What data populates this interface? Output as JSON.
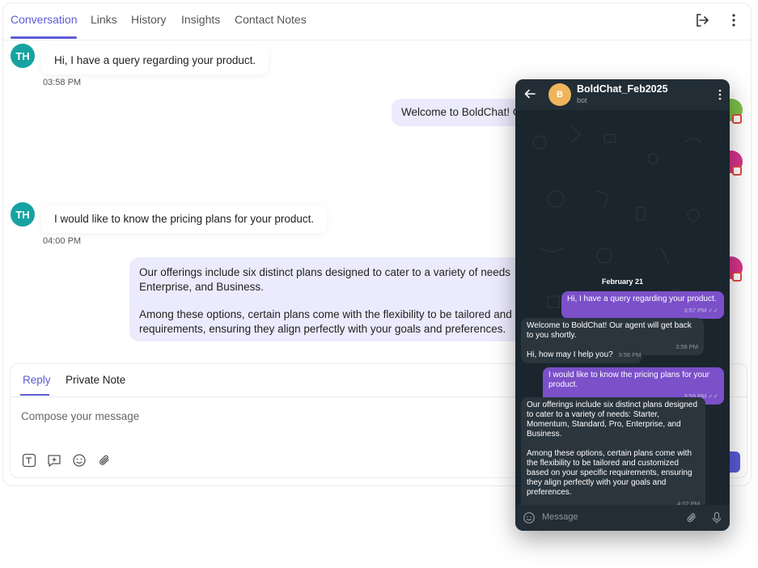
{
  "tabs": [
    {
      "label": "Conversation"
    },
    {
      "label": "Links"
    },
    {
      "label": "History"
    },
    {
      "label": "Insights"
    },
    {
      "label": "Contact Notes"
    }
  ],
  "header_icons": [
    "logout-icon",
    "more-vertical-icon"
  ],
  "messages": [
    {
      "avatar": "TH",
      "text": "Hi, I have a query regarding your product.",
      "time": "03:58 PM"
    },
    {
      "text": "Welcome to BoldChat! O"
    },
    {
      "avatar": "TH",
      "text": "I would like to know the pricing plans for your product.",
      "time": "04:00 PM"
    },
    {
      "line1": "Our offerings include six distinct plans designed to cater to a variety of needs",
      "line2": "Enterprise, and Business.",
      "line3": "Among these options, certain plans come with the flexibility to be tailored and",
      "line4": "requirements, ensuring they align perfectly with your goals and preferences."
    }
  ],
  "composer": {
    "tabs": [
      {
        "label": "Reply"
      },
      {
        "label": "Private Note"
      }
    ],
    "placeholder": "Compose your message",
    "tools": [
      "text-format-icon",
      "quick-reply-icon",
      "emoji-icon",
      "attachment-icon"
    ]
  },
  "phone": {
    "avatar": "B",
    "title": "BoldChat_Feb2025",
    "subtitle": "bot",
    "date": "February 21",
    "messages": [
      {
        "side": "out",
        "text": "Hi, I have a query regarding your product.",
        "time": "3:57 PM ✓✓"
      },
      {
        "side": "in",
        "text": "Welcome to BoldChat! Our agent will get back to you shortly.",
        "time": "3:58 PM"
      },
      {
        "side": "in",
        "text": "Hi, how may I help you?",
        "time": "3:58 PM"
      },
      {
        "side": "out",
        "text": "I would like to know the pricing plans for your product.",
        "time": "3:59 PM ✓✓"
      },
      {
        "side": "in",
        "p1": "Our offerings include six distinct plans designed to cater to a variety of needs: Starter, Momentum, Standard, Pro, Enterprise, and Business.",
        "p2": "Among these options, certain plans come with the flexibility to be tailored and customized based on your specific requirements, ensuring they align perfectly with your goals and preferences.",
        "time": "4:02 PM"
      }
    ],
    "input_placeholder": "Message"
  },
  "colors": {
    "accent": "#5b5bd6",
    "avatar": "#17a2a0",
    "phone_out_bubble": "#7b50c9",
    "phone_bg": "#1b252d"
  }
}
